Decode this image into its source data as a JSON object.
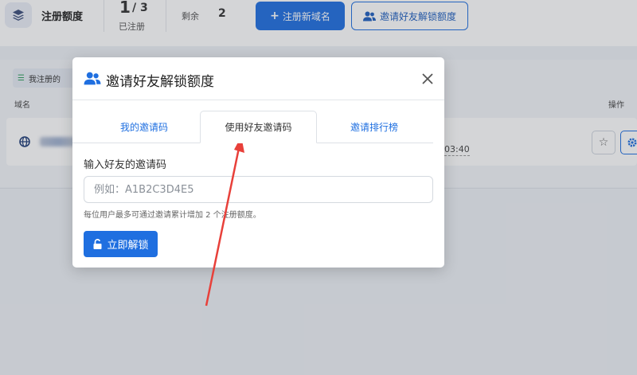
{
  "header": {
    "quota_label": "注册额度",
    "used": "1",
    "total": "/ 3",
    "used_label": "已注册",
    "remaining_label": "剩余",
    "remaining_value": "2",
    "register_button": "注册新域名",
    "invite_button": "邀请好友解锁额度"
  },
  "list": {
    "tab_label": "我注册的",
    "col_domain": "域名",
    "col_actions": "操作",
    "row_time": "03:40"
  },
  "modal": {
    "title": "邀请好友解锁额度",
    "tabs": [
      {
        "label": "我的邀请码",
        "active": false
      },
      {
        "label": "使用好友邀请码",
        "active": true
      },
      {
        "label": "邀请排行榜",
        "active": false
      }
    ],
    "field_label": "输入好友的邀请码",
    "input_placeholder": "例如：A1B2C3D4E5",
    "input_value": "",
    "help_text": "每位用户最多可通过邀请累计增加 2 个注册额度。",
    "unlock_button": "立即解锁"
  },
  "icons": {
    "brand": "layers-icon",
    "register": "plus-icon",
    "invite": "users-icon",
    "list": "list-icon",
    "domain": "globe-icon",
    "favorite": "star-icon",
    "settings": "gear-icon",
    "close": "close-icon",
    "unlock": "unlock-icon"
  },
  "colors": {
    "primary": "#1f6fe0",
    "annotation_arrow": "#e8403a"
  }
}
